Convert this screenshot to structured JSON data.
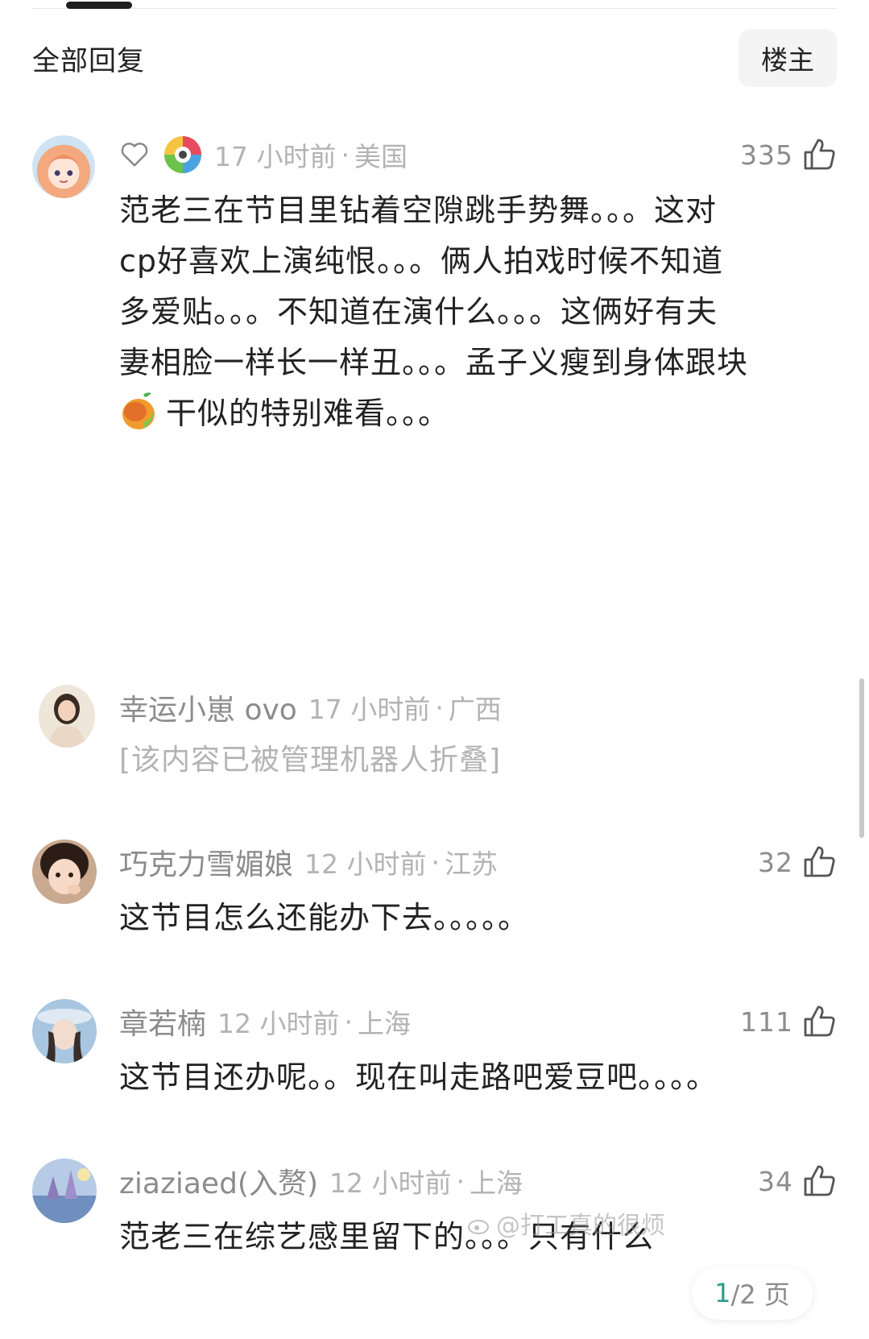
{
  "header": {
    "title": "全部回复",
    "filter_label": "楼主"
  },
  "comments": [
    {
      "time": "17 小时前",
      "location": "美国",
      "likes": "335",
      "text_lines": [
        "范老三在节目里钻着空隙跳手势舞。。。这对",
        "cp好喜欢上演纯恨。。。俩人拍戏时候不知道",
        "多爱贴。。。不知道在演什么。。。这俩好有夫",
        "妻相脸一样长一样丑。。。孟子义瘦到身体跟块",
        "干似的特别难看。。。"
      ]
    },
    {
      "name": "幸运小崽 ovo",
      "time": "17 小时前",
      "location": "广西",
      "text": "[该内容已被管理机器人折叠]"
    },
    {
      "name": "巧克力雪媚娘",
      "time": "12 小时前",
      "location": "江苏",
      "likes": "32",
      "text": "这节目怎么还能办下去。。。。。"
    },
    {
      "name": "章若楠",
      "time": "12 小时前",
      "location": "上海",
      "likes": "111",
      "text": "这节目还办呢。。现在叫走路吧爱豆吧。。。。"
    },
    {
      "name": "ziaziaed(入赘)",
      "time": "12 小时前",
      "location": "上海",
      "likes": "34",
      "text": "范老三在综艺感里留下的。。。只有什么"
    }
  ],
  "pager": {
    "current": "1",
    "total": "/2 页"
  },
  "watermark": "@打工真的很烦",
  "colors": {
    "accent": "#2a9d8f",
    "meta_gray": "#b3b3b3",
    "name_gray": "#8c8c8c"
  }
}
